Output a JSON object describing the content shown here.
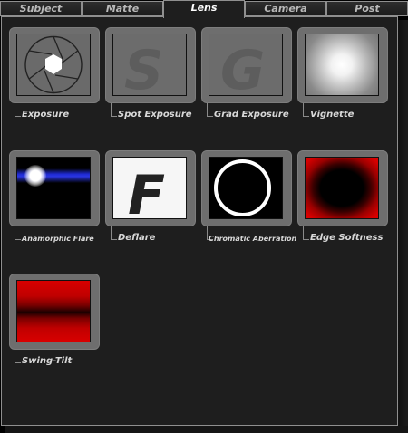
{
  "tabs": [
    {
      "label": "Subject",
      "active": false
    },
    {
      "label": "Matte",
      "active": false
    },
    {
      "label": "Lens",
      "active": true
    },
    {
      "label": "Camera",
      "active": false
    },
    {
      "label": "Post",
      "active": false
    }
  ],
  "presets": [
    {
      "label": "Exposure",
      "icon": "aperture-icon"
    },
    {
      "label": "Spot Exposure",
      "icon": "letter-s-icon",
      "letter": "S"
    },
    {
      "label": "Grad Exposure",
      "icon": "letter-g-icon",
      "letter": "G"
    },
    {
      "label": "Vignette",
      "icon": "vignette-icon"
    },
    {
      "label": "Anamorphic Flare",
      "icon": "anamorphic-flare-icon"
    },
    {
      "label": "Deflare",
      "icon": "letter-f-icon",
      "letter": "F"
    },
    {
      "label": "Chromatic Aberration",
      "icon": "ring-icon"
    },
    {
      "label": "Edge Softness",
      "icon": "edge-softness-icon"
    },
    {
      "label": "Swing-Tilt",
      "icon": "swing-tilt-icon"
    }
  ],
  "colors": {
    "panel_bg": "#1e1e1e",
    "frame": "#6e6e6e",
    "label": "#d8d8d8",
    "tab_text": "#b9b9b9",
    "tab_active_text": "#ffffff",
    "flare_blue": "#1f2bd6",
    "edge_red": "#d40000"
  }
}
